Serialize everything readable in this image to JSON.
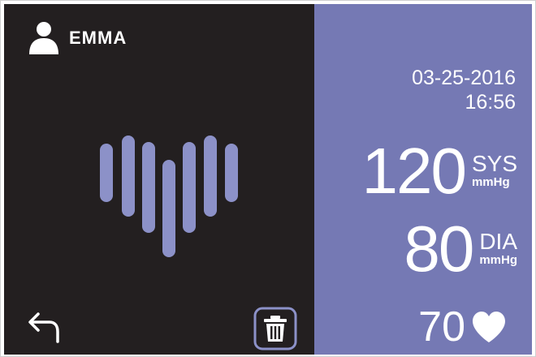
{
  "user": {
    "name": "EMMA",
    "icon": "user-icon"
  },
  "measurement": {
    "date": "03-25-2016",
    "time": "16:56",
    "systolic": {
      "value": "120",
      "label": "SYS",
      "unit": "mmHg"
    },
    "diastolic": {
      "value": "80",
      "label": "DIA",
      "unit": "mmHg"
    },
    "pulse": {
      "value": "70",
      "icon": "heart-icon"
    }
  },
  "controls": {
    "back_icon": "back-arrow-icon",
    "delete_icon": "trash-icon"
  },
  "colors": {
    "left_panel": "#231f20",
    "right_panel": "#7579b4",
    "bars": "#8c91c8",
    "text": "#ffffff"
  }
}
